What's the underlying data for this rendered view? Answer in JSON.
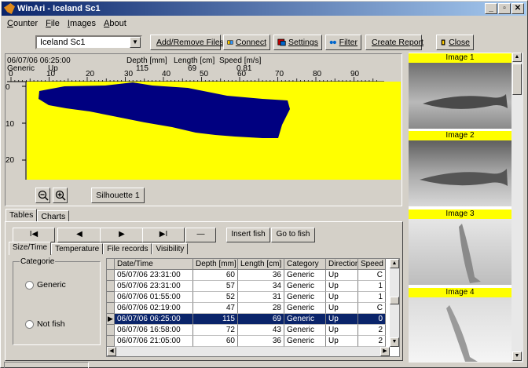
{
  "window": {
    "title": "WinAri - Iceland Sc1"
  },
  "menu": [
    "Counter",
    "File",
    "Images",
    "About"
  ],
  "toolbar": {
    "combo_value": "Iceland Sc1",
    "add_remove": "Add/Remove Files",
    "connect": "Connect",
    "settings": "Settings",
    "filter": "Filter",
    "create_report": "Create Report",
    "close": "Close"
  },
  "info": {
    "datetime": "06/07/06 06:25:00",
    "category": "Generic",
    "direction": "Up",
    "depth_label": "Depth [mm]",
    "depth_value": "115",
    "length_label": "Length [cm]",
    "length_value": "69",
    "speed_label": "Speed [m/s]",
    "speed_value": "0.81"
  },
  "ruler_labels": [
    "0",
    "10",
    "20",
    "30",
    "40",
    "50",
    "60",
    "70",
    "80",
    "90"
  ],
  "y_labels": [
    "0",
    "10",
    "20"
  ],
  "silhouette_button": "Silhouette 1",
  "main_tabs": [
    "Tables",
    "Charts"
  ],
  "nav": {
    "first": "I◀",
    "prev": "◀",
    "next": "▶",
    "last": "▶I",
    "delete": "—",
    "insert_fish": "Insert fish",
    "go_to_fish": "Go to fish"
  },
  "sub_tabs": [
    "Size/Time",
    "Temperature",
    "File records",
    "Visibility"
  ],
  "category_group": {
    "label": "Categorie",
    "options": [
      "Generic",
      "Not fish"
    ]
  },
  "table": {
    "headers": [
      "Date/Time",
      "Depth [mm]",
      "Length [cm]",
      "Category",
      "Direction",
      "Speed [m"
    ],
    "rows": [
      [
        "05/07/06 23:31:00",
        "60",
        "36",
        "Generic",
        "Up",
        "C"
      ],
      [
        "05/07/06 23:31:00",
        "57",
        "34",
        "Generic",
        "Up",
        "1"
      ],
      [
        "06/07/06 01:55:00",
        "52",
        "31",
        "Generic",
        "Up",
        "1"
      ],
      [
        "06/07/06 02:19:00",
        "47",
        "28",
        "Generic",
        "Up",
        "C"
      ],
      [
        "06/07/06 06:25:00",
        "115",
        "69",
        "Generic",
        "Up",
        "0"
      ],
      [
        "06/07/06 16:58:00",
        "72",
        "43",
        "Generic",
        "Up",
        "2"
      ],
      [
        "06/07/06 21:05:00",
        "60",
        "36",
        "Generic",
        "Up",
        "2"
      ]
    ]
  },
  "images": [
    "Image 1",
    "Image 2",
    "Image 3",
    "Image 4"
  ],
  "colors": {
    "plot_bg": "#ffff00",
    "silhouette": "#000080",
    "selection": "#0a246a"
  }
}
